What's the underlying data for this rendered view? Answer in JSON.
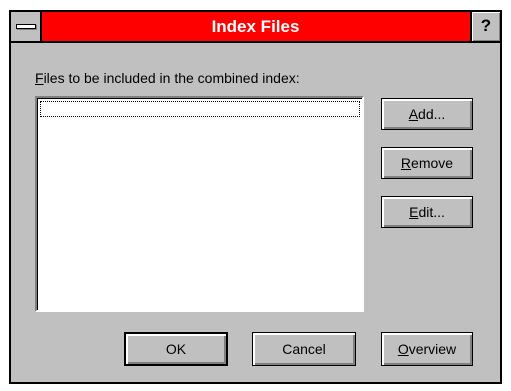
{
  "window": {
    "title": "Index Files",
    "help_label": "?"
  },
  "files": {
    "label_accel": "F",
    "label_rest": "iles to be included in the combined index:",
    "items": []
  },
  "buttons": {
    "add": {
      "accel": "A",
      "rest": "dd..."
    },
    "remove": {
      "accel": "R",
      "rest": "emove"
    },
    "edit": {
      "accel": "E",
      "rest": "dit..."
    },
    "ok": {
      "label": "OK"
    },
    "cancel": {
      "label": "Cancel"
    },
    "overview": {
      "accel": "O",
      "rest": "verview"
    }
  },
  "colors": {
    "titlebar": "#ff0000",
    "face": "#c0c0c0"
  }
}
